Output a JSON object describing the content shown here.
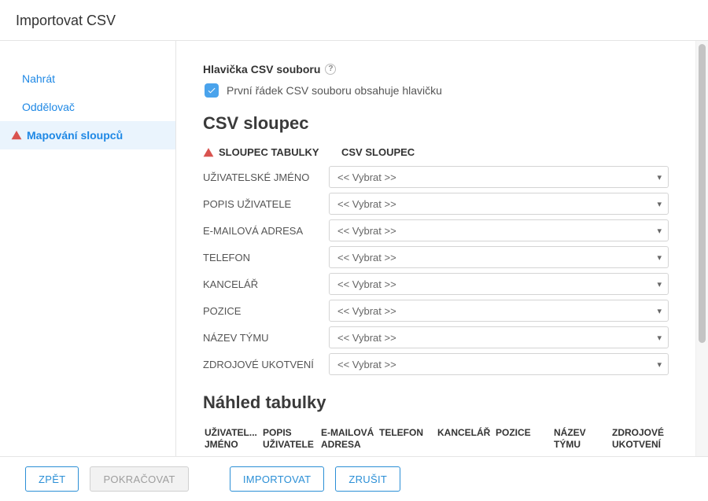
{
  "title": "Importovat CSV",
  "sidebar": {
    "items": [
      {
        "label": "Nahrát"
      },
      {
        "label": "Oddělovač"
      },
      {
        "label": "Mapování sloupců"
      }
    ]
  },
  "header_section": {
    "title": "Hlavička CSV souboru",
    "checkbox_label": "První řádek CSV souboru obsahuje hlavičku"
  },
  "csv_section": {
    "heading": "CSV sloupec",
    "col_a_header": "SLOUPEC TABULKY",
    "col_b_header": "CSV SLOUPEC",
    "select_placeholder": "<< Vybrat >>",
    "rows": [
      {
        "label": "UŽIVATELSKÉ JMÉNO"
      },
      {
        "label": "POPIS UŽIVATELE"
      },
      {
        "label": "E-MAILOVÁ ADRESA"
      },
      {
        "label": "TELEFON"
      },
      {
        "label": "KANCELÁŘ"
      },
      {
        "label": "POZICE"
      },
      {
        "label": "NÁZEV TÝMU"
      },
      {
        "label": "ZDROJOVÉ UKOTVENÍ"
      }
    ]
  },
  "preview": {
    "heading": "Náhled tabulky",
    "columns": [
      "UŽIVATEL... JMÉNO",
      "POPIS UŽIVATELE",
      "E-MAILOVÁ ADRESA",
      "TELEFON",
      "KANCELÁŘ",
      "POZICE",
      "NÁZEV TÝMU",
      "ZDROJOVÉ UKOTVENÍ"
    ]
  },
  "footer": {
    "back": "ZPĚT",
    "continue": "POKRAČOVAT",
    "import": "IMPORTOVAT",
    "cancel": "ZRUŠIT"
  }
}
